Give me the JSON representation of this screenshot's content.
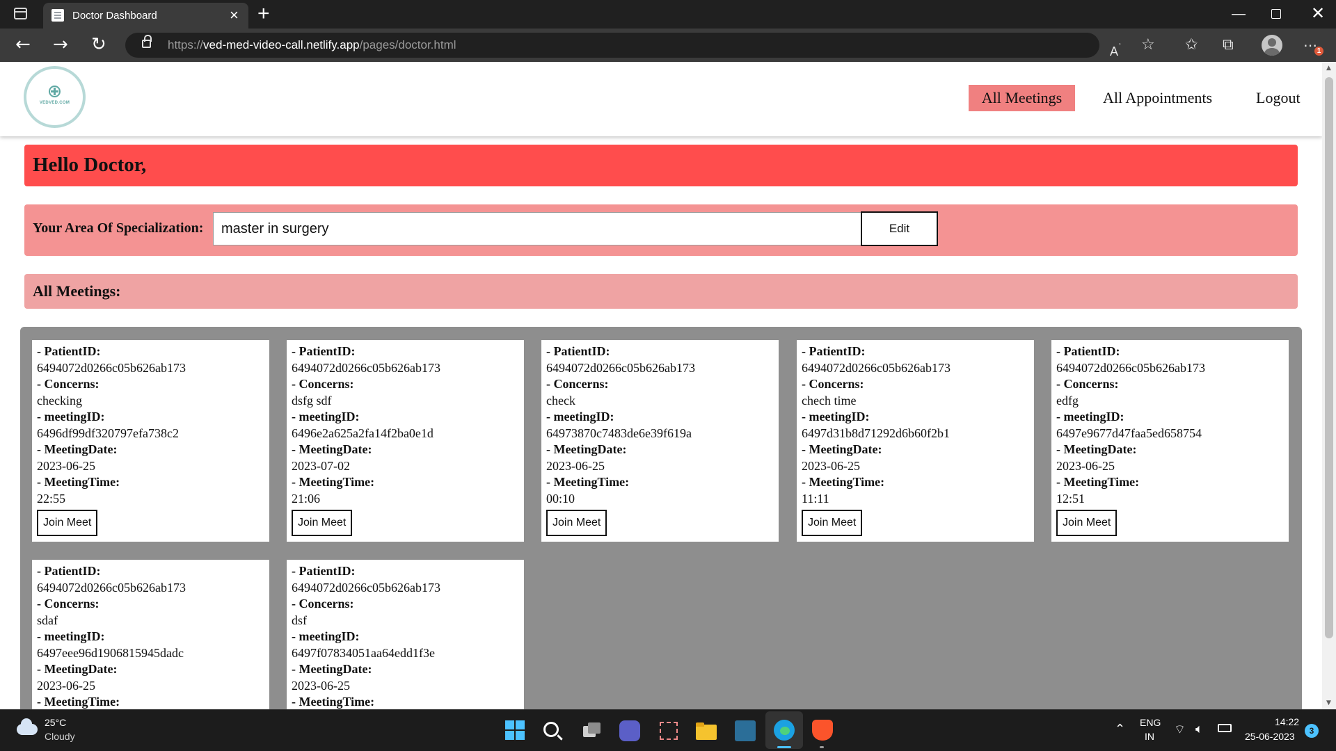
{
  "browser": {
    "tab_title": "Doctor Dashboard",
    "url_prefix": "https://",
    "url_host": "ved-med-video-call.netlify.app",
    "url_path": "/pages/doctor.html",
    "read_aloud_icon": "read-aloud-icon",
    "notification_count": "1"
  },
  "header": {
    "logo_text": "VEDVED.COM",
    "nav": {
      "all_meetings": "All Meetings",
      "all_appointments": "All Appointments",
      "logout": "Logout"
    }
  },
  "greeting": "Hello Doctor,",
  "specialization": {
    "label": "Your Area Of Specialization:",
    "value": "master in surgery",
    "edit_label": "Edit"
  },
  "meetings": {
    "title": "All Meetings:",
    "labels": {
      "patient_id": "- PatientID:",
      "concerns": "- Concerns:",
      "meeting_id": "- meetingID:",
      "meeting_date": "- MeetingDate:",
      "meeting_time": "- MeetingTime:"
    },
    "join_label": "Join Meet",
    "items": [
      {
        "patient_id": "6494072d0266c05b626ab173",
        "concerns": "checking",
        "meeting_id": "6496df99df320797efa738c2",
        "meeting_date": "2023-06-25",
        "meeting_time": "22:55"
      },
      {
        "patient_id": "6494072d0266c05b626ab173",
        "concerns": "dsfg sdf",
        "meeting_id": "6496e2a625a2fa14f2ba0e1d",
        "meeting_date": "2023-07-02",
        "meeting_time": "21:06"
      },
      {
        "patient_id": "6494072d0266c05b626ab173",
        "concerns": "check",
        "meeting_id": "64973870c7483de6e39f619a",
        "meeting_date": "2023-06-25",
        "meeting_time": "00:10"
      },
      {
        "patient_id": "6494072d0266c05b626ab173",
        "concerns": "chech time",
        "meeting_id": "6497d31b8d71292d6b60f2b1",
        "meeting_date": "2023-06-25",
        "meeting_time": "11:11"
      },
      {
        "patient_id": "6494072d0266c05b626ab173",
        "concerns": "edfg",
        "meeting_id": "6497e9677d47faa5ed658754",
        "meeting_date": "2023-06-25",
        "meeting_time": "12:51"
      },
      {
        "patient_id": "6494072d0266c05b626ab173",
        "concerns": "sdaf",
        "meeting_id": "6497eee96d1906815945dadc",
        "meeting_date": "2023-06-25",
        "meeting_time": ""
      },
      {
        "patient_id": "6494072d0266c05b626ab173",
        "concerns": "dsf",
        "meeting_id": "6497f07834051aa64edd1f3e",
        "meeting_date": "2023-06-25",
        "meeting_time": ""
      }
    ]
  },
  "taskbar": {
    "temperature": "25°C",
    "weather": "Cloudy",
    "lang_line1": "ENG",
    "lang_line2": "IN",
    "time": "14:22",
    "date": "25-06-2023",
    "notification_count": "3"
  }
}
